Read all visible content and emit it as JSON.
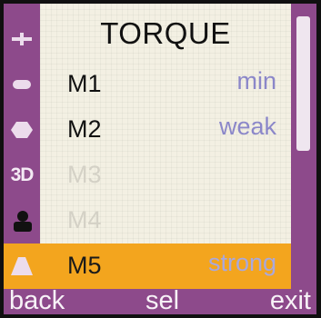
{
  "screen": {
    "title": "TORQUE"
  },
  "sidebar": {
    "items": [
      {
        "icon": "drill-icon"
      },
      {
        "icon": "bar-icon"
      },
      {
        "icon": "hexagon-icon"
      },
      {
        "label": "3D"
      },
      {
        "icon": "person-icon"
      },
      {
        "icon": "trapezoid-icon"
      }
    ]
  },
  "menu": {
    "items": [
      {
        "code": "M1",
        "level": "min",
        "state": "enabled"
      },
      {
        "code": "M2",
        "level": "weak",
        "state": "enabled"
      },
      {
        "code": "M3",
        "level": "",
        "state": "disabled"
      },
      {
        "code": "M4",
        "level": "",
        "state": "disabled"
      },
      {
        "code": "M5",
        "level": "strong",
        "state": "selected"
      }
    ]
  },
  "softkeys": {
    "left": "back",
    "center": "sel",
    "right": "exit"
  },
  "colors": {
    "frame": "#8d4a8b",
    "highlight": "#f3a51e",
    "level_text": "#8b87c9",
    "background": "#f3f0e3"
  }
}
